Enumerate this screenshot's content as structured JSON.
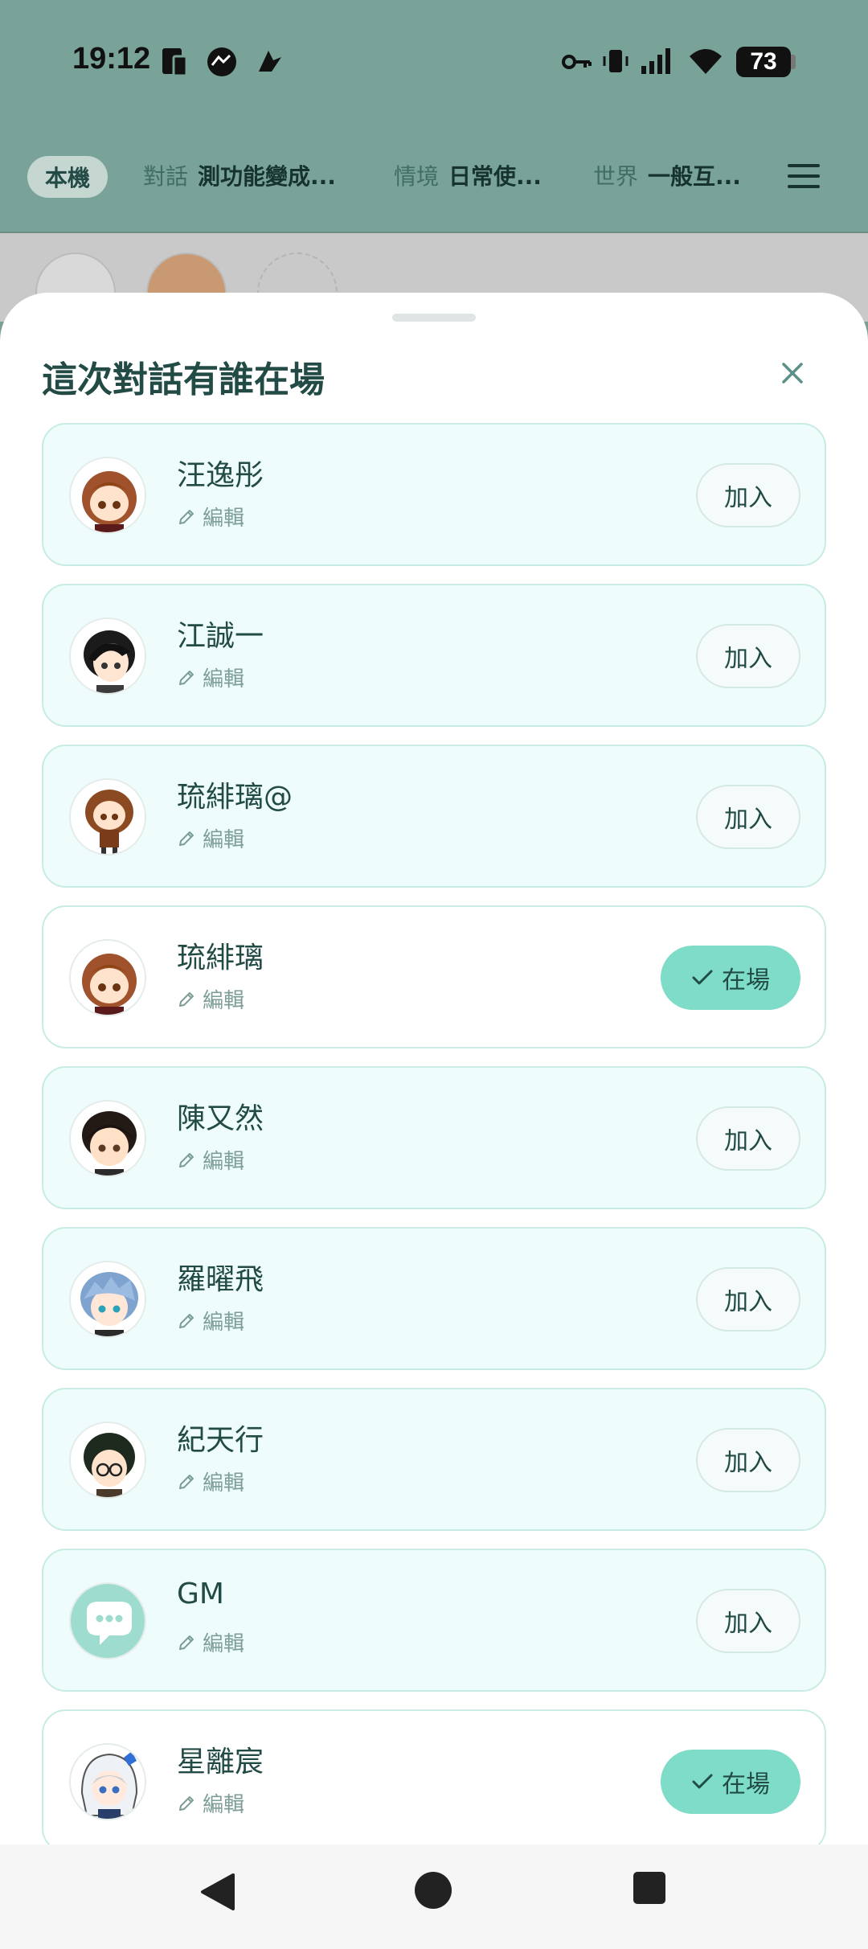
{
  "status": {
    "time": "19:12",
    "battery": "73"
  },
  "top_bar": {
    "device_chip": "本機",
    "contexts": [
      {
        "key": "對話",
        "value": "測功能變成..."
      },
      {
        "key": "情境",
        "value": "日常使..."
      },
      {
        "key": "世界",
        "value": "一般互..."
      }
    ]
  },
  "sheet": {
    "title": "這次對話有誰在場",
    "edit_label": "編輯",
    "join_label": "加入",
    "present_label": "在場"
  },
  "characters": [
    {
      "name": "汪逸彤",
      "present": false,
      "avatar": "brown-hair-girl-avatar"
    },
    {
      "name": "江誠一",
      "present": false,
      "avatar": "black-hair-boy-avatar"
    },
    {
      "name": "琉緋璃@",
      "present": false,
      "avatar": "chibi-brown-hair-girl-avatar"
    },
    {
      "name": "琉緋璃",
      "present": true,
      "avatar": "brown-hair-girl-avatar"
    },
    {
      "name": "陳又然",
      "present": false,
      "avatar": "dark-hair-boy-avatar"
    },
    {
      "name": "羅曜飛",
      "present": false,
      "avatar": "blue-hair-boy-avatar"
    },
    {
      "name": "紀天行",
      "present": false,
      "avatar": "glasses-boy-avatar"
    },
    {
      "name": "GM",
      "present": false,
      "avatar": "chat-bubble-avatar"
    },
    {
      "name": "星離宸",
      "present": true,
      "avatar": "silver-hair-hood-avatar"
    }
  ],
  "colors": {
    "header_bg": "#79a398",
    "accent": "#7fdcc9",
    "card_bg": "#eefdfc",
    "text": "#234b46"
  }
}
